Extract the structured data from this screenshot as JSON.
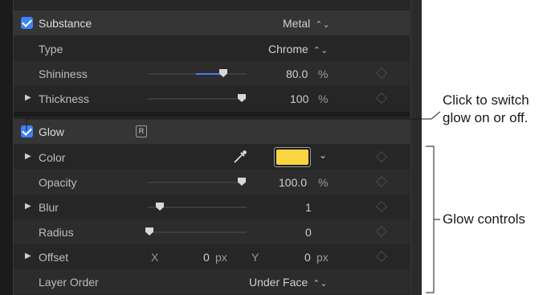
{
  "colors": {
    "accent": "#3e82f7",
    "glow_color": "#f9d53f",
    "slider_fill": "#4a78f0"
  },
  "substance": {
    "checkbox_checked": true,
    "label": "Substance",
    "value": "Metal",
    "rows": {
      "type": {
        "label": "Type",
        "value": "Chrome"
      },
      "shininess": {
        "label": "Shininess",
        "value": "80.0",
        "unit": "%",
        "slider_fraction": 0.8
      },
      "thickness": {
        "label": "Thickness",
        "value": "100",
        "unit": "%",
        "slider_fraction": 1.0
      }
    }
  },
  "glow": {
    "checkbox_checked": true,
    "label": "Glow",
    "badge": "R",
    "rows": {
      "color": {
        "label": "Color",
        "swatch": "#f9d53f"
      },
      "opacity": {
        "label": "Opacity",
        "value": "100.0",
        "unit": "%",
        "slider_fraction": 1.0
      },
      "blur": {
        "label": "Blur",
        "value": "1",
        "slider_fraction": 0.12
      },
      "radius": {
        "label": "Radius",
        "value": "0",
        "slider_fraction": 0.0
      },
      "offset": {
        "label": "Offset",
        "x_label": "X",
        "x_value": "0",
        "x_unit": "px",
        "y_label": "Y",
        "y_value": "0",
        "y_unit": "px"
      },
      "layer_order": {
        "label": "Layer Order",
        "value": "Under Face"
      }
    }
  },
  "callouts": {
    "switch": "Click to switch glow on or off.",
    "switch_line1": "Click to switch",
    "switch_line2": "glow on or off.",
    "controls": "Glow controls"
  },
  "icons": {
    "disclosure": "▶",
    "popup": "⌃⌄",
    "chevron": "⌄",
    "eyedropper": "eyedropper-icon"
  }
}
